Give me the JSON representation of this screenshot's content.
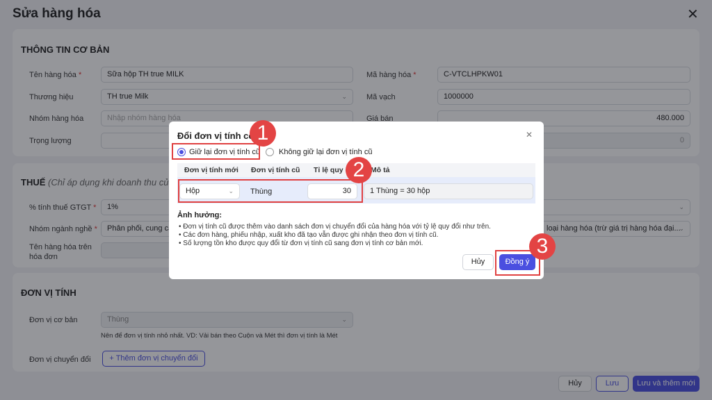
{
  "page": {
    "title": "Sửa hàng hóa"
  },
  "basic": {
    "heading": "THÔNG TIN CƠ BẢN",
    "name_label": "Tên hàng hóa",
    "name_value": "Sữa hộp TH true MILK",
    "brand_label": "Thương hiệu",
    "brand_value": "TH true Milk",
    "group_label": "Nhóm hàng hóa",
    "group_placeholder": "Nhập nhóm hàng hóa",
    "weight_label": "Trọng lượng",
    "code_label": "Mã hàng hóa",
    "code_value": "C-VTCLHPKW01",
    "barcode_label": "Mã vạch",
    "barcode_value": "1000000",
    "price_label": "Giá bán",
    "price_value": "480.000",
    "weight_value": "0"
  },
  "tax": {
    "heading": "THUẾ",
    "note": "(Chỉ áp dụng khi doanh thu của",
    "vat_label": "% tính thuế GTGT",
    "vat_value": "1%",
    "industry_label": "Nhóm ngành nghề",
    "industry_value": "Phân phối, cung cấp",
    "industry_right": "loại hàng hóa (trừ giá trị hàng hóa đại...",
    "invoice_label": "Tên hàng hóa trên hóa đơn"
  },
  "unit": {
    "heading": "ĐƠN VỊ TÍNH",
    "base_label": "Đơn vị cơ bản",
    "base_value": "Thùng",
    "hint": "Nên để đơn vị tính nhỏ nhất. VD: Vải bán theo Cuộn và Mét thì đơn vị tính là Mét",
    "conv_label": "Đơn vị chuyển đổi",
    "add_conv": "+ Thêm đơn vị chuyển đổi"
  },
  "footer": {
    "cancel": "Hủy",
    "save": "Lưu",
    "save_new": "Lưu và thêm mới"
  },
  "modal": {
    "title": "Đổi đơn vị tính cơ bản",
    "keep": "Giữ lại đơn vị tính cũ",
    "nokeep": "Không giữ lại đơn vị tính cũ",
    "cols": [
      "Đơn vị tính mới",
      "Đơn vị tính cũ",
      "Tỉ lệ quy đổi",
      "Mô tả"
    ],
    "row": {
      "new_unit": "Hộp",
      "old_unit": "Thùng",
      "ratio": "30",
      "desc": "1 Thùng = 30 hộp"
    },
    "impact_heading": "Ảnh hưởng:",
    "impacts": [
      "Đơn vị tính cũ được thêm vào danh sách đơn vị chuyển đổi của hàng hóa với tỷ lệ quy đổi như trên.",
      "Các đơn hàng, phiếu nhập, xuất kho đã tạo vẫn được ghi nhận theo đơn vị tính cũ.",
      "Số lượng tồn kho được quy đổi từ đơn vị tính cũ sang đơn vị tính cơ bản mới."
    ],
    "cancel": "Hủy",
    "ok": "Đồng ý"
  },
  "steps": [
    "1",
    "2",
    "3"
  ]
}
